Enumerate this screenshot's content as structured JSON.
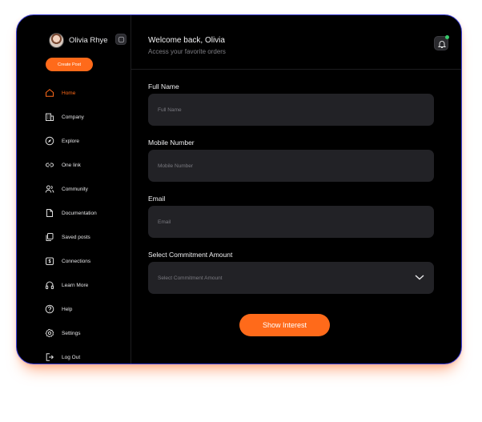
{
  "profile": {
    "name": "Olivia Rhye"
  },
  "sidebar": {
    "create_post_label": "Create Post",
    "items": [
      {
        "label": "Home",
        "icon": "home-icon",
        "active": true
      },
      {
        "label": "Company",
        "icon": "building-icon"
      },
      {
        "label": "Explore",
        "icon": "compass-icon"
      },
      {
        "label": "One link",
        "icon": "link-icon"
      },
      {
        "label": "Community",
        "icon": "users-icon"
      },
      {
        "label": "Documentation",
        "icon": "file-icon"
      },
      {
        "label": "Saved posts",
        "icon": "bookmark-copy-icon"
      },
      {
        "label": "Connections",
        "icon": "dollar-box-icon"
      },
      {
        "label": "Learn More",
        "icon": "headphones-icon"
      },
      {
        "label": "Help",
        "icon": "help-icon"
      },
      {
        "label": "Settings",
        "icon": "gear-icon"
      },
      {
        "label": "Log Out",
        "icon": "logout-icon"
      }
    ]
  },
  "header": {
    "welcome": "Welcome back, Olivia",
    "subtitle": "Access your favorite orders"
  },
  "form": {
    "full_name": {
      "label": "Full Name",
      "placeholder": "Full Name"
    },
    "mobile": {
      "label": "Mobile Number",
      "placeholder": "Mobile Number"
    },
    "email": {
      "label": "Email",
      "placeholder": "Email"
    },
    "commitment": {
      "label": "Select Commitment Amount",
      "placeholder": "Select Commitment Amount"
    },
    "submit_label": "Show Interest"
  },
  "colors": {
    "accent": "#ff6a1a",
    "background": "#000000",
    "field": "#222226",
    "notification": "#38c96b"
  }
}
